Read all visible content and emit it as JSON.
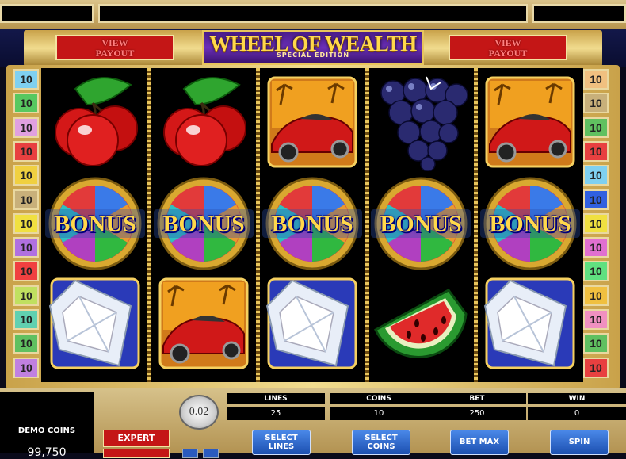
{
  "header": {
    "view_payout_left_line1": "VIEW",
    "view_payout_left_line2": "PAYOUT",
    "view_payout_right_line1": "VIEW",
    "view_payout_right_line2": "PAYOUT",
    "logo_title": "WHEEL OF WEALTH",
    "logo_subtitle": "SPECIAL EDITION"
  },
  "left_lines": [
    "10",
    "10",
    "10",
    "10",
    "10",
    "10",
    "10",
    "10",
    "10",
    "10",
    "10",
    "10",
    "10"
  ],
  "right_lines": [
    "10",
    "10",
    "10",
    "10",
    "10",
    "10",
    "10",
    "10",
    "10",
    "10",
    "10",
    "10",
    "10"
  ],
  "line_colors": {
    "left": [
      "#7fd0f0",
      "#58c860",
      "#e0a0e0",
      "#e84040",
      "#f0d040",
      "#c8b07a",
      "#f0e040",
      "#b070e0",
      "#f04040",
      "#c0e060",
      "#60d0b0",
      "#60c060",
      "#c080e0"
    ],
    "right": [
      "#f0c080",
      "#c8b07a",
      "#60c060",
      "#e84040",
      "#7fd0f0",
      "#3060e0",
      "#f0e040",
      "#e070d0",
      "#60e080",
      "#f0c040",
      "#f090c0",
      "#60c060",
      "#e84040"
    ]
  },
  "bonus_label": "BONUS",
  "reels": [
    [
      "cherry",
      "bonus",
      "diamond"
    ],
    [
      "cherry",
      "bonus",
      "car"
    ],
    [
      "car",
      "bonus",
      "diamond"
    ],
    [
      "grapes",
      "bonus",
      "watermelon"
    ],
    [
      "car",
      "bonus",
      "diamond"
    ]
  ],
  "controls": {
    "demo_coins_label": "DEMO COINS",
    "demo_coins_value": "99,750",
    "expert_label": "EXPERT",
    "coin_value": "0.02",
    "lines_label": "LINES",
    "lines_value": "25",
    "coins_label": "COINS",
    "coins_value": "10",
    "bet_label": "BET",
    "bet_value": "250",
    "win_label": "WIN",
    "win_value": "0",
    "select_lines_l1": "SELECT",
    "select_lines_l2": "LINES",
    "select_coins_l1": "SELECT",
    "select_coins_l2": "COINS",
    "bet_max_label": "BET MAX",
    "spin_label": "SPIN"
  },
  "colors": {
    "gold": "#e8c55c",
    "red_button": "#c41616",
    "blue_button": "#2b64d0",
    "logo_purple": "#5a22a0"
  }
}
